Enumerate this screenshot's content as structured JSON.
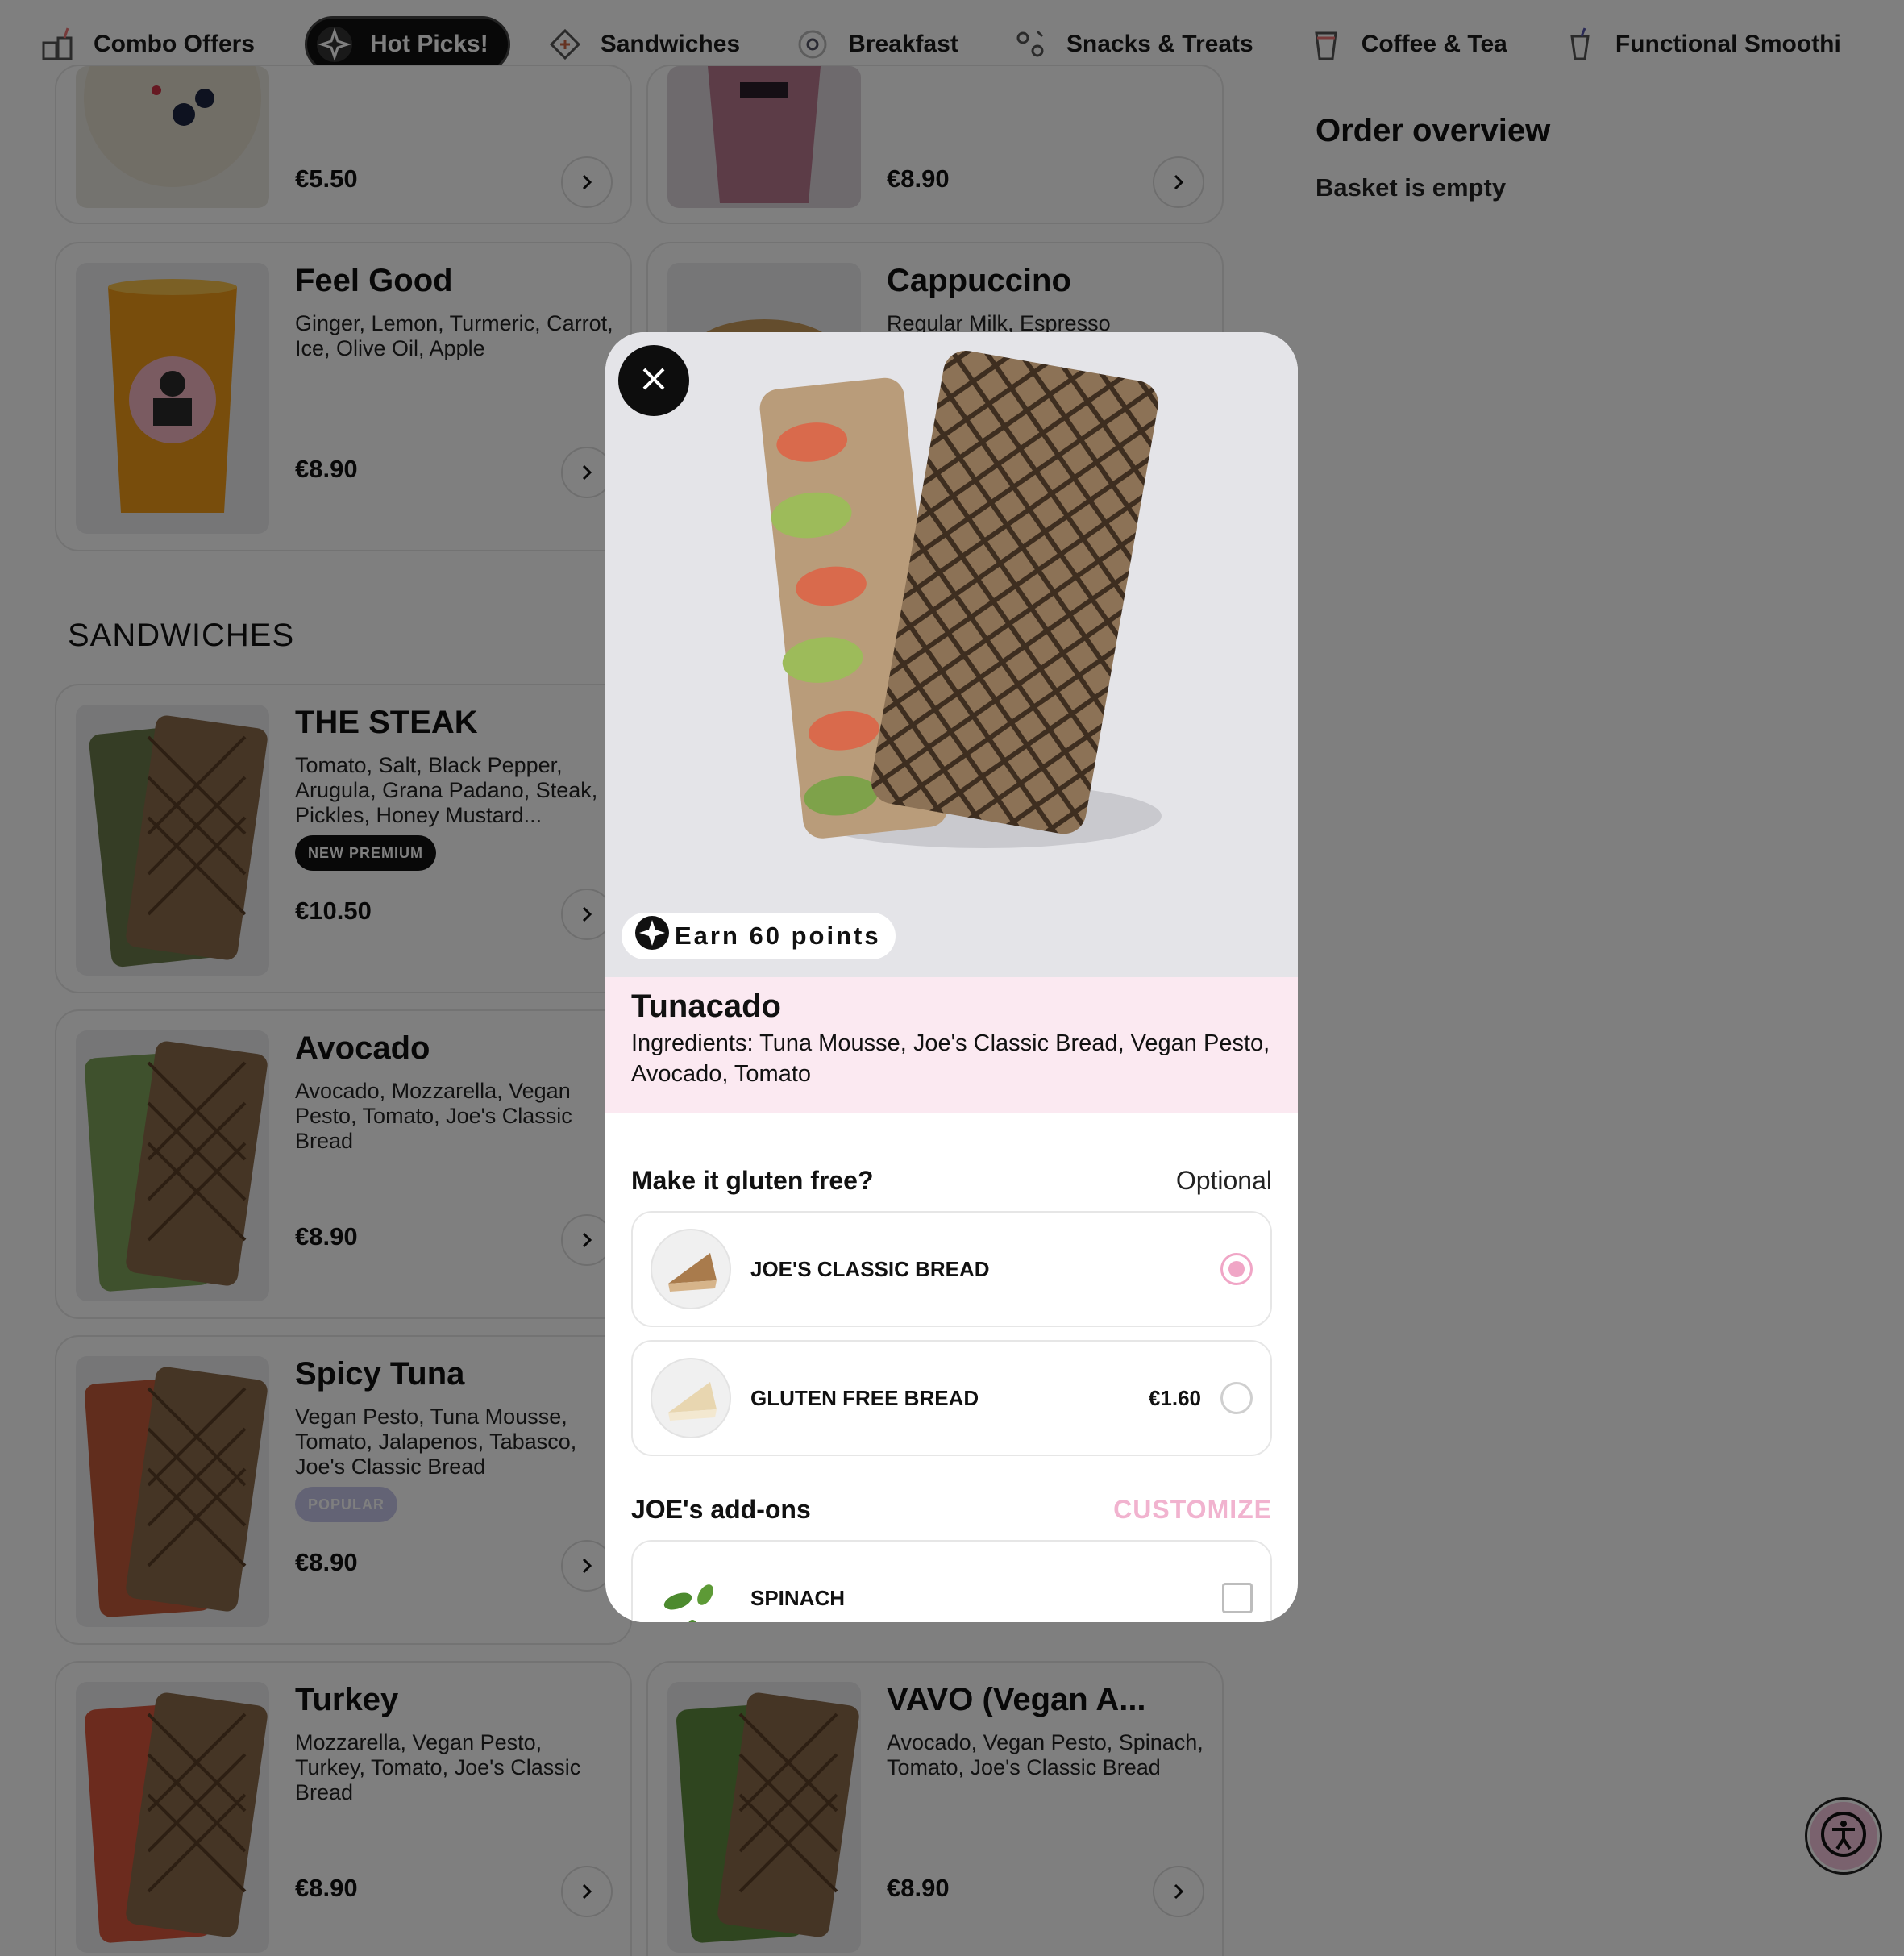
{
  "nav": {
    "items": [
      {
        "label": "Combo Offers",
        "icon": "combo-icon"
      },
      {
        "label": "Hot Picks!",
        "icon": "sparkle-icon",
        "active": true
      },
      {
        "label": "Sandwiches",
        "icon": "sandwich-icon"
      },
      {
        "label": "Breakfast",
        "icon": "egg-icon"
      },
      {
        "label": "Snacks & Treats",
        "icon": "snack-icon"
      },
      {
        "label": "Coffee & Tea",
        "icon": "cup-icon"
      },
      {
        "label": "Functional Smoothi",
        "icon": "smoothie-icon"
      }
    ]
  },
  "menu": {
    "top_cards": [
      {
        "price": "€5.50"
      },
      {
        "price": "€8.90"
      }
    ],
    "feel_good": {
      "title": "Feel Good",
      "desc": "Ginger, Lemon, Turmeric, Carrot, Ice, Olive Oil, Apple",
      "price": "€8.90"
    },
    "cappuccino": {
      "title": "Cappuccino",
      "desc": "Regular Milk, Espresso"
    },
    "section_title": "SANDWICHES",
    "steak": {
      "title": "THE STEAK",
      "desc": "Tomato, Salt, Black Pepper, Arugula, Grana Padano, Steak, Pickles, Honey Mustard...",
      "badge": "NEW PREMIUM",
      "price": "€10.50"
    },
    "avocado": {
      "title": "Avocado",
      "desc": "Avocado, Mozzarella, Vegan Pesto, Tomato, Joe's Classic Bread",
      "price": "€8.90"
    },
    "spicy_tuna": {
      "title": "Spicy Tuna",
      "desc": "Vegan Pesto, Tuna Mousse, Tomato, Jalapenos, Tabasco, Joe's Classic Bread",
      "badge": "POPULAR",
      "price": "€8.90"
    },
    "turkey": {
      "title": "Turkey",
      "desc": "Mozzarella, Vegan Pesto, Turkey, Tomato, Joe's Classic Bread",
      "price": "€8.90"
    },
    "vavo": {
      "title": "VAVO (Vegan A...",
      "desc": "Avocado, Vegan Pesto, Spinach, Tomato, Joe's Classic Bread",
      "price": "€8.90"
    }
  },
  "order": {
    "title": "Order overview",
    "empty": "Basket is empty"
  },
  "modal": {
    "points": "Earn 60 points",
    "name": "Tunacado",
    "ingredients": "Ingredients: Tuna Mousse, Joe's Classic Bread, Vegan Pesto, Avocado, Tomato",
    "gluten": {
      "title": "Make it gluten free?",
      "tag": "Optional",
      "options": [
        {
          "label": "JOE'S CLASSIC BREAD",
          "price": "",
          "selected": true
        },
        {
          "label": "GLUTEN FREE BREAD",
          "price": "€1.60",
          "selected": false
        }
      ]
    },
    "addons": {
      "title": "JOE's add-ons",
      "action": "CUSTOMIZE",
      "items": [
        {
          "label": "SPINACH"
        }
      ]
    }
  },
  "colors": {
    "accent_pink": "#f0a6c6",
    "info_bg": "#fbe9f1",
    "dark": "#111111"
  }
}
